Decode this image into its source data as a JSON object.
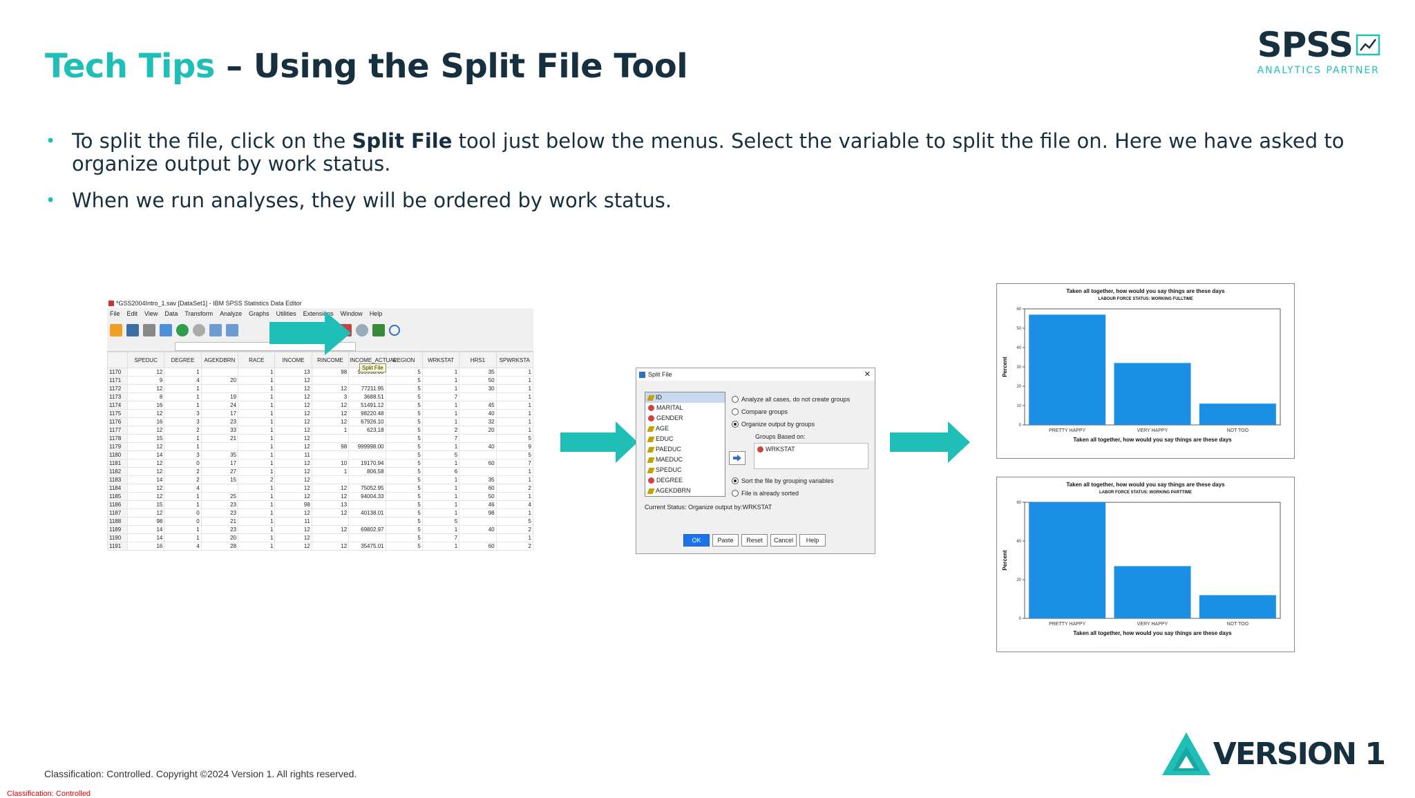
{
  "slide": {
    "title_part1": "Tech Tips",
    "title_part2": "– Using the Split File Tool",
    "bullet1_pre": "To split the file, click on the ",
    "bullet1_bold": "Split File",
    "bullet1_post": " tool just below the menus. Select the variable to split the file on. Here we have asked to organize output by work status.",
    "bullet2": "When we run analyses, they will be ordered by work status.",
    "footer": "Classification: Controlled. Copyright ©2024 Version 1. All rights reserved.",
    "classification": "Classification: Controlled"
  },
  "logos": {
    "spss_big": "SPSS",
    "spss_sub": "ANALYTICS PARTNER",
    "version1": "VERSION 1",
    "brand_teal": "#1fbfb8",
    "brand_navy": "#17303f"
  },
  "editor": {
    "title": "*GSS2004Intro_1.sav [DataSet1] - IBM SPSS Statistics Data Editor",
    "menus": [
      "File",
      "Edit",
      "View",
      "Data",
      "Transform",
      "Analyze",
      "Graphs",
      "Utilities",
      "Extensions",
      "Window",
      "Help"
    ],
    "tooltip": "Split File",
    "columns": [
      "SPEDUC",
      "DEGREE",
      "AGEKDBRN",
      "RACE",
      "INCOME",
      "RINCOME",
      "INCOME_ACTUAL",
      "REGION",
      "WRKSTAT",
      "HRS1",
      "SPWRKSTA"
    ],
    "rows": [
      [
        "1170",
        "12",
        "1",
        "",
        "1",
        "13",
        "98",
        "999998.00",
        "5",
        "1",
        "35",
        "1"
      ],
      [
        "1171",
        "9",
        "4",
        "20",
        "1",
        "12",
        "",
        "",
        "5",
        "1",
        "50",
        "1"
      ],
      [
        "1172",
        "12",
        "1",
        "",
        "1",
        "12",
        "12",
        "77211.95",
        "5",
        "1",
        "30",
        "1"
      ],
      [
        "1173",
        "8",
        "1",
        "19",
        "1",
        "12",
        "3",
        "3688.51",
        "5",
        "7",
        "",
        "1"
      ],
      [
        "1174",
        "16",
        "1",
        "24",
        "1",
        "12",
        "12",
        "51491.12",
        "5",
        "1",
        "45",
        "1"
      ],
      [
        "1175",
        "12",
        "3",
        "17",
        "1",
        "12",
        "12",
        "98220.48",
        "5",
        "1",
        "40",
        "1"
      ],
      [
        "1176",
        "16",
        "3",
        "23",
        "1",
        "12",
        "12",
        "67926.10",
        "5",
        "1",
        "32",
        "1"
      ],
      [
        "1177",
        "12",
        "2",
        "33",
        "1",
        "12",
        "1",
        "623.18",
        "5",
        "2",
        "20",
        "1"
      ],
      [
        "1178",
        "15",
        "1",
        "21",
        "1",
        "12",
        "",
        "",
        "5",
        "7",
        "",
        "5"
      ],
      [
        "1179",
        "12",
        "1",
        "",
        "1",
        "12",
        "98",
        "999998.00",
        "5",
        "1",
        "40",
        "9"
      ],
      [
        "1180",
        "14",
        "3",
        "35",
        "1",
        "11",
        "",
        "",
        "5",
        "5",
        "",
        "5"
      ],
      [
        "1181",
        "12",
        "0",
        "17",
        "1",
        "12",
        "10",
        "19170.94",
        "5",
        "1",
        "60",
        "7"
      ],
      [
        "1182",
        "12",
        "2",
        "27",
        "1",
        "12",
        "1",
        "806.58",
        "5",
        "6",
        "",
        "1"
      ],
      [
        "1183",
        "14",
        "2",
        "15",
        "2",
        "12",
        "",
        "",
        "5",
        "1",
        "35",
        "1"
      ],
      [
        "1184",
        "12",
        "4",
        "",
        "1",
        "12",
        "12",
        "75052.95",
        "5",
        "1",
        "60",
        "2"
      ],
      [
        "1185",
        "12",
        "1",
        "25",
        "1",
        "12",
        "12",
        "94004.33",
        "5",
        "1",
        "50",
        "1"
      ],
      [
        "1186",
        "15",
        "1",
        "23",
        "1",
        "98",
        "13",
        "",
        "5",
        "1",
        "46",
        "4"
      ],
      [
        "1187",
        "12",
        "0",
        "23",
        "1",
        "12",
        "12",
        "40138.01",
        "5",
        "1",
        "98",
        "1"
      ],
      [
        "1188",
        "98",
        "0",
        "21",
        "1",
        "11",
        "",
        "",
        "5",
        "5",
        "",
        "5"
      ],
      [
        "1189",
        "14",
        "1",
        "23",
        "1",
        "12",
        "12",
        "69802.97",
        "5",
        "1",
        "40",
        "2"
      ],
      [
        "1190",
        "14",
        "1",
        "20",
        "1",
        "12",
        "",
        "",
        "5",
        "7",
        "",
        "1"
      ],
      [
        "1191",
        "16",
        "4",
        "28",
        "1",
        "12",
        "12",
        "35475.01",
        "5",
        "1",
        "60",
        "2"
      ]
    ]
  },
  "dialog": {
    "title": "Split File",
    "variables": [
      "ID",
      "MARITAL",
      "GENDER",
      "AGE",
      "EDUC",
      "PAEDUC",
      "MAEDUC",
      "SPEDUC",
      "DEGREE",
      "AGEKDBRN"
    ],
    "opt_analyze": "Analyze all cases, do not create groups",
    "opt_compare": "Compare groups",
    "opt_organize": "Organize output by groups",
    "groups_label": "Groups Based on:",
    "groups_value": "WRKSTAT",
    "opt_sort": "Sort the file by grouping variables",
    "opt_sorted": "File is already sorted",
    "status": "Current Status: Organize output by:WRKSTAT",
    "buttons": [
      "OK",
      "Paste",
      "Reset",
      "Cancel",
      "Help"
    ]
  },
  "chart_data": [
    {
      "type": "bar",
      "title": "Taken all together, how would you say things are these days",
      "subtitle": "LABOUR FORCE STATUS: WORKING FULLTIME",
      "categories": [
        "PRETTY HAPPY",
        "VERY HAPPY",
        "NOT TOO"
      ],
      "values": [
        57,
        32,
        11
      ],
      "xlabel": "Taken all together, how would you say things are these days",
      "ylabel": "Percent",
      "ylim": [
        0,
        60
      ],
      "yticks": [
        0,
        10,
        20,
        30,
        40,
        50,
        60
      ],
      "color": "#1a8fe3"
    },
    {
      "type": "bar",
      "title": "Taken all together, how would you say things are these days",
      "subtitle": "LABOR FORCE STATUS: WORKING PARTTIME",
      "categories": [
        "PRETTY HAPPY",
        "VERY HAPPY",
        "NOT TOO"
      ],
      "values": [
        60,
        27,
        12
      ],
      "xlabel": "Taken all together, how would you say things are these days",
      "ylabel": "Percent",
      "ylim": [
        0,
        60
      ],
      "yticks": [
        0,
        20,
        40,
        60
      ],
      "color": "#1a8fe3"
    }
  ]
}
